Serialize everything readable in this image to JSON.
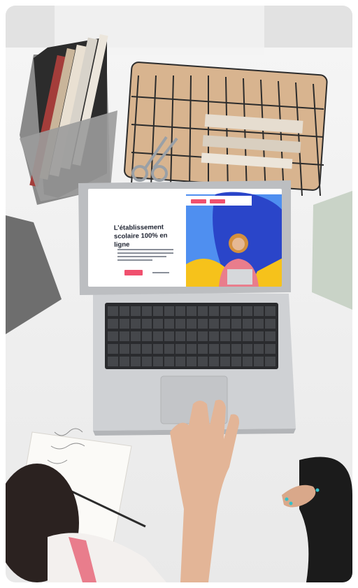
{
  "screen": {
    "headline": "L’établissement scolaire 100% en ligne"
  },
  "colors": {
    "table": "#efefef",
    "laptop_body": "#cfd1d4",
    "keyboard": "#2a2b2e",
    "screen_bg": "#ffffff",
    "hero_blue": "#4f8ff0",
    "hero_deep_blue": "#2a45c9",
    "hero_yellow": "#f6c21b",
    "cta_red": "#f0506e",
    "cork": "#d8b48f",
    "felt_gray": "#767676",
    "shirt_pink": "#e97d8c"
  },
  "icons": {
    "photo": "photo-icon"
  }
}
